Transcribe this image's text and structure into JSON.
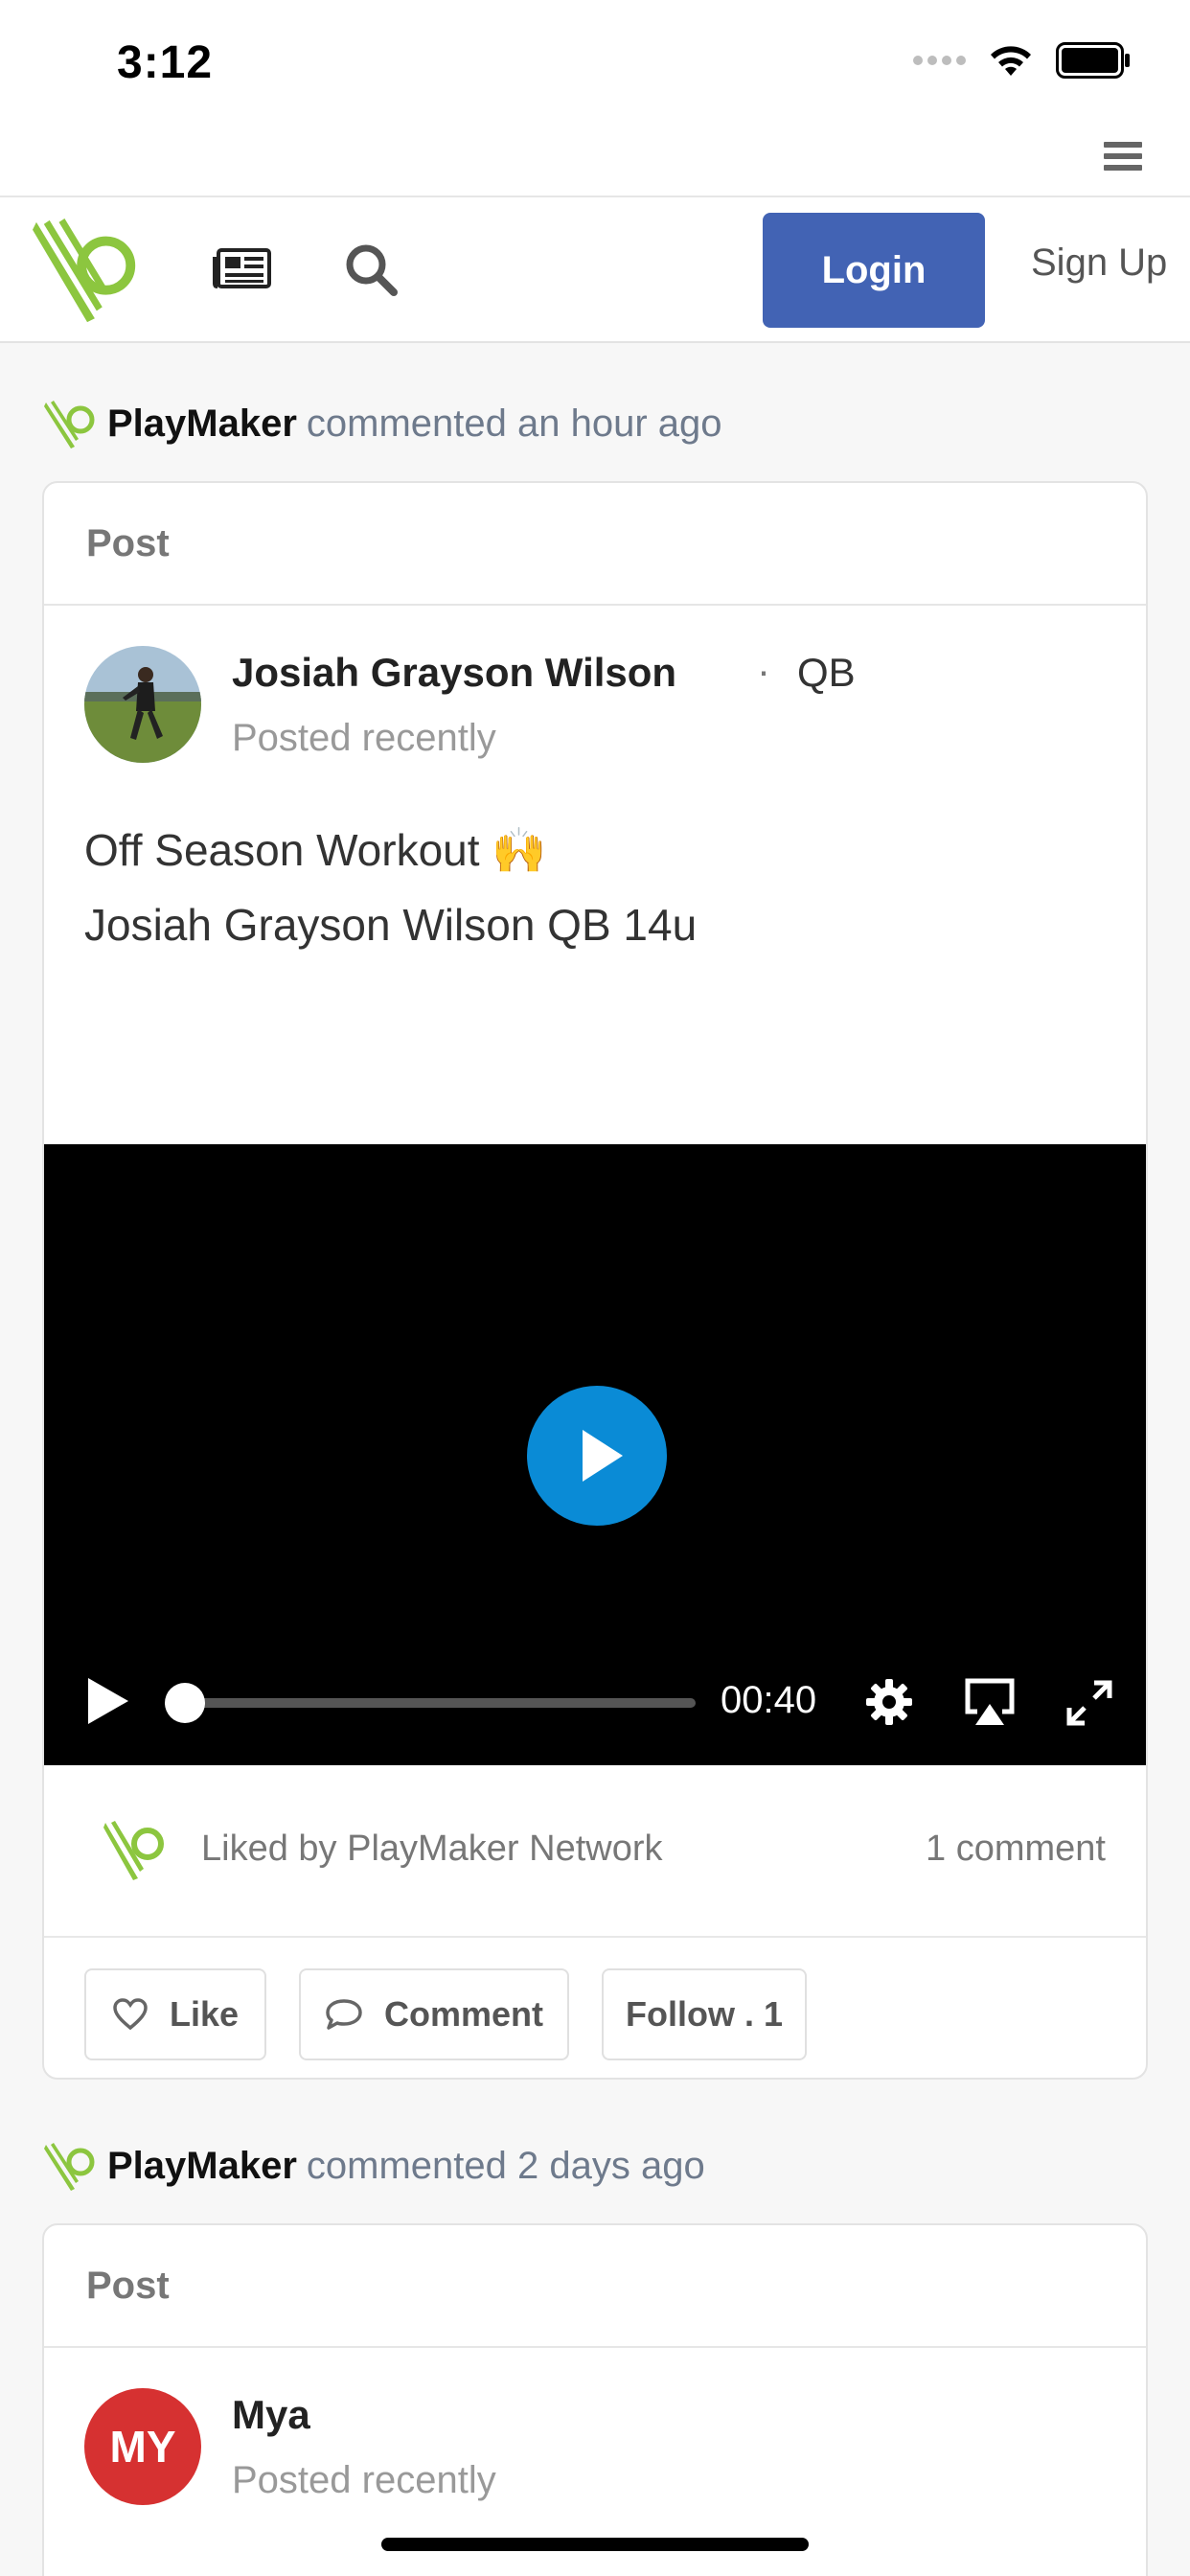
{
  "status_bar": {
    "time": "3:12"
  },
  "nav": {
    "login_label": "Login",
    "signup_label": "Sign Up"
  },
  "feed": [
    {
      "activity": {
        "actor": "PlayMaker",
        "verb": "commented an hour ago"
      },
      "card_header": "Post",
      "author": {
        "name": "Josiah Grayson Wilson",
        "separator": "·",
        "position": "QB",
        "time": "Posted recently"
      },
      "text_lines": [
        "Off Season Workout 🙌",
        "Josiah Grayson Wilson QB 14u"
      ],
      "video": {
        "duration": "00:40",
        "progress": 0
      },
      "liked_by": "Liked by PlayMaker Network",
      "comment_count": "1 comment",
      "actions": {
        "like": "Like",
        "comment": "Comment",
        "follow": "Follow . 1"
      }
    },
    {
      "activity": {
        "actor": "PlayMaker",
        "verb": "commented 2 days ago"
      },
      "card_header": "Post",
      "author": {
        "initials": "MY",
        "name": "Mya",
        "time": "Posted recently"
      }
    }
  ],
  "colors": {
    "brand_green": "#8cc63f",
    "login_blue": "#4263b4",
    "play_blue": "#0a8bd6",
    "avatar_red": "#d63131"
  },
  "icons": [
    "wifi-icon",
    "battery-icon",
    "hamburger-icon",
    "playmaker-logo",
    "newspaper-icon",
    "search-icon",
    "play-icon",
    "gear-icon",
    "airplay-icon",
    "fullscreen-icon",
    "heart-icon",
    "comment-icon"
  ]
}
